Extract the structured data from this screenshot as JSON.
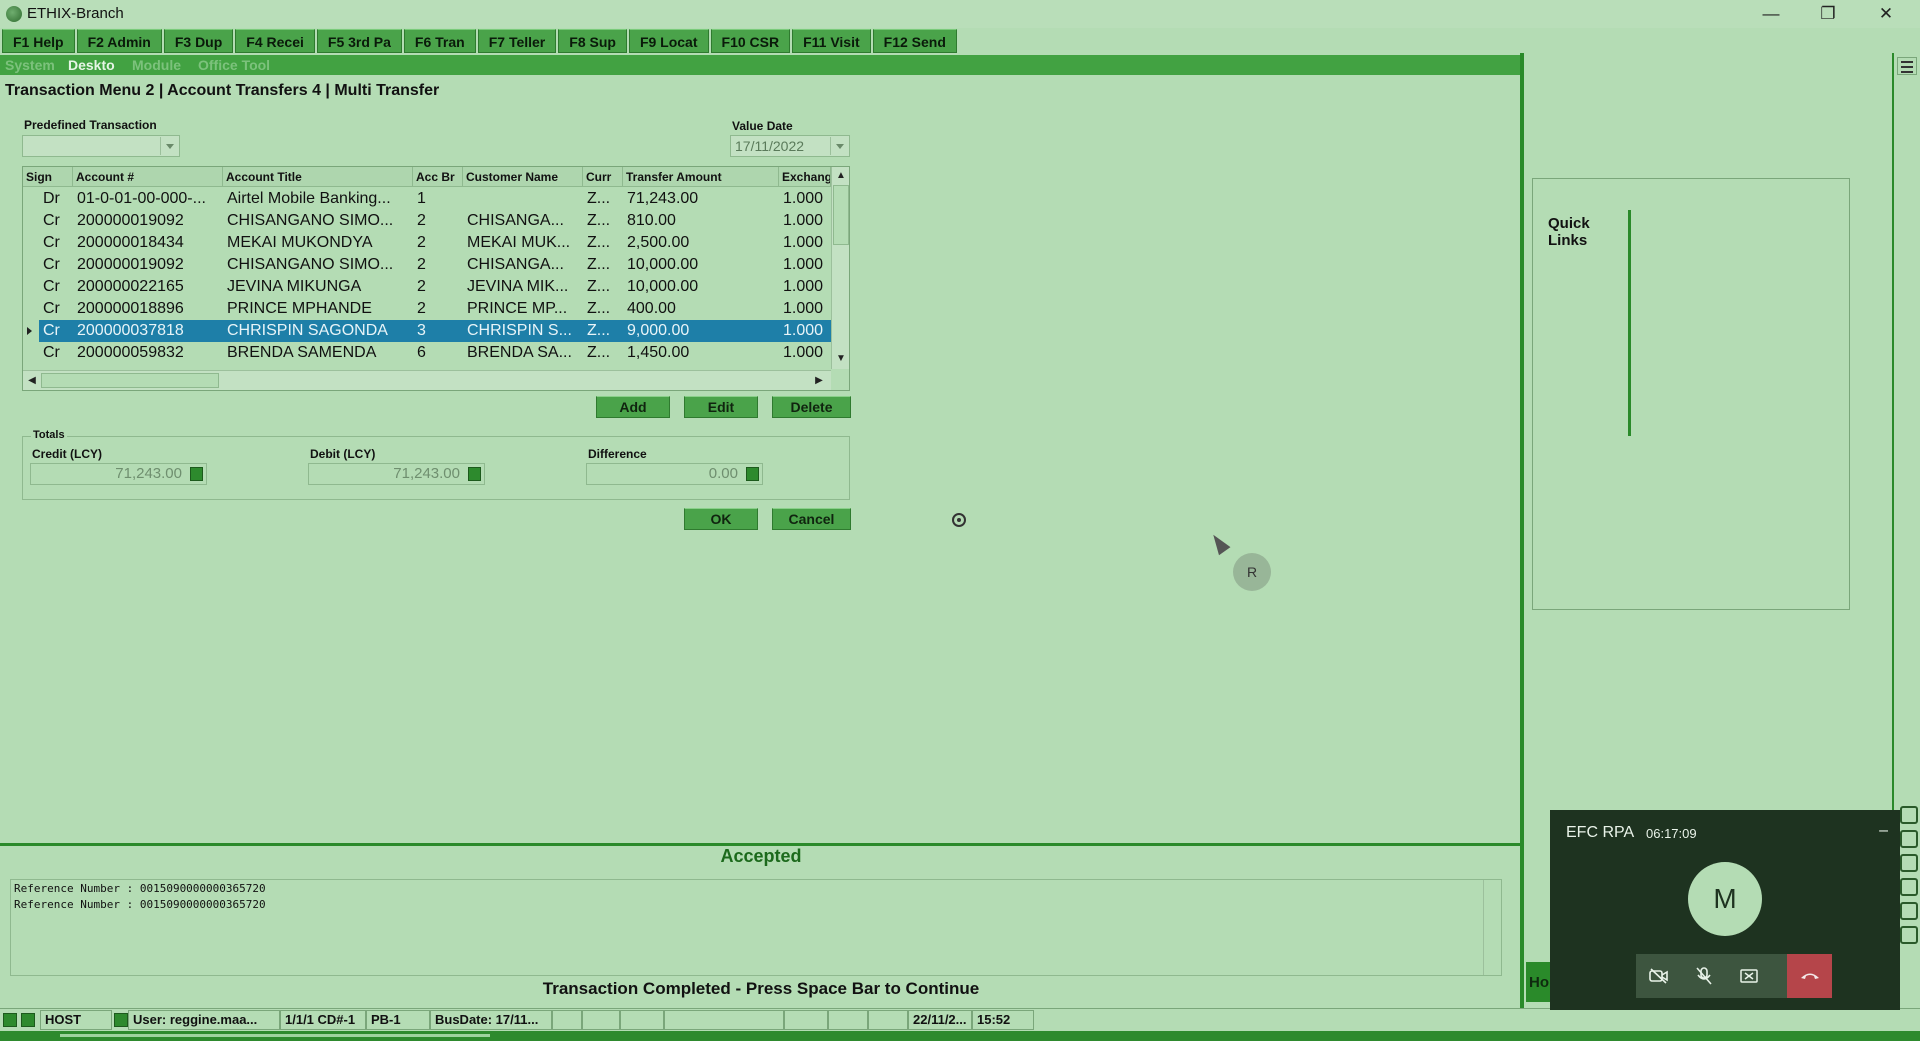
{
  "window": {
    "title": "ETHIX-Branch",
    "controls": [
      "—",
      "❐",
      "✕"
    ]
  },
  "fkeys": [
    "F1 Help",
    "F2 Admin",
    "F3 Dup",
    "F4 Recei",
    "F5 3rd Pa",
    "F6 Tran",
    "F7 Teller",
    "F8 Sup",
    "F9 Locat",
    "F10 CSR",
    "F11 Visit",
    "F12 Send"
  ],
  "menu": [
    "System",
    "Deskto",
    "Module",
    "Office Tool"
  ],
  "breadcrumb": "Transaction Menu  2 | Account Transfers   4 | Multi Transfer",
  "form": {
    "predefined_label": "Predefined Transaction",
    "predefined_value": "",
    "value_date_label": "Value Date",
    "value_date": "17/11/2022"
  },
  "grid": {
    "headers": [
      "Sign",
      "Account #",
      "Account Title",
      "Acc Br",
      "Customer Name",
      "Curr",
      "Transfer Amount",
      "Exchang"
    ],
    "rows": [
      [
        "Dr",
        "01-0-01-00-000-...",
        "Airtel Mobile Banking...",
        "1",
        "",
        "Z...",
        "71,243.00",
        "1.000"
      ],
      [
        "Cr",
        "200000019092",
        "CHISANGANO SIMO...",
        "2",
        "CHISANGA...",
        "Z...",
        "810.00",
        "1.000"
      ],
      [
        "Cr",
        "200000018434",
        "MEKAI MUKONDYA",
        "2",
        "MEKAI MUK...",
        "Z...",
        "2,500.00",
        "1.000"
      ],
      [
        "Cr",
        "200000019092",
        "CHISANGANO SIMO...",
        "2",
        "CHISANGA...",
        "Z...",
        "10,000.00",
        "1.000"
      ],
      [
        "Cr",
        "200000022165",
        "JEVINA MIKUNGA",
        "2",
        "JEVINA MIK...",
        "Z...",
        "10,000.00",
        "1.000"
      ],
      [
        "Cr",
        "200000018896",
        "PRINCE MPHANDE",
        "2",
        "PRINCE MP...",
        "Z...",
        "400.00",
        "1.000"
      ],
      [
        "Cr",
        "200000037818",
        "CHRISPIN SAGONDA",
        "3",
        "CHRISPIN S...",
        "Z...",
        "9,000.00",
        "1.000"
      ],
      [
        "Cr",
        "200000059832",
        "BRENDA SAMENDA",
        "6",
        "BRENDA SA...",
        "Z...",
        "1,450.00",
        "1.000"
      ]
    ],
    "selected_row": 6
  },
  "buttons": {
    "add": "Add",
    "edit": "Edit",
    "delete": "Delete",
    "ok": "OK",
    "cancel": "Cancel"
  },
  "totals": {
    "title": "Totals",
    "credit_label": "Credit (LCY)",
    "credit_value": "71,243.00",
    "debit_label": "Debit (LCY)",
    "debit_value": "71,243.00",
    "difference_label": "Difference",
    "difference_value": "0.00"
  },
  "overlay": {
    "avatar_letter": "R"
  },
  "quick_links": {
    "title_line1": "Quick",
    "title_line2": "Links"
  },
  "result": {
    "status": "Accepted",
    "log_lines": [
      "Reference Number : 0015090000000365720",
      "Reference Number : 0015090000000365720"
    ],
    "message": "Transaction Completed - Press Space Bar to Continue"
  },
  "statusbar": {
    "host": "HOST",
    "user": "User: reggine.maa...",
    "session": "1/1/1 CD#-1",
    "pb": "PB-1",
    "busdate": "BusDate: 17/11...",
    "date": "22/11/2...",
    "time": "15:52"
  },
  "call": {
    "name": "EFC RPA",
    "duration": "06:17:09",
    "avatar_letter": "M",
    "minimize": "–"
  },
  "side_tab": "Ho",
  "colors": {
    "background": "#b4dcb4",
    "fkey": "#4aa34a",
    "selection": "#1e7fa8",
    "accepted": "#1c6a1c",
    "end_call": "#b5454a"
  }
}
